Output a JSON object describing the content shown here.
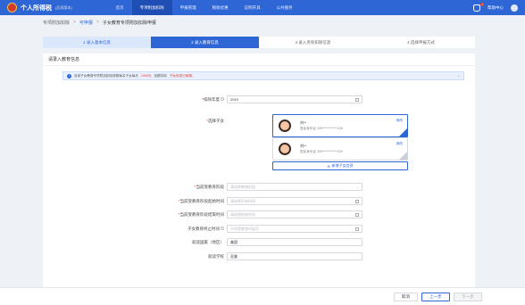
{
  "header": {
    "title": "个人所得税",
    "subtitle": "(后续版本)",
    "nav": [
      "首页",
      "专项附加扣除",
      "申报管理",
      "税收优惠",
      "证明开具",
      "公共服务"
    ],
    "notify_count": "1",
    "user_link": "帮助中心"
  },
  "breadcrumb": [
    "专项附加扣除",
    "可申报",
    "子女教育专项附加扣除申报"
  ],
  "steps": [
    "1 录入基本信息",
    "2 录入教育信息",
    "3 录入另有扣除信息",
    "4 选择申报方式"
  ],
  "section_title": "请录入教育信息",
  "notice": {
    "text": "目前子女教育专项附加扣除按照每名子女每月",
    "highlight": "1000元",
    "text2": "定额扣除",
    "highlight2": "子女信息已填报。"
  },
  "form": {
    "year_label": "扣除年度",
    "year_value": "2019",
    "child_label": "选择子女",
    "children": [
      {
        "name": "刘**",
        "id": "居民身份证   339************228",
        "edit": "修改"
      },
      {
        "name": "刘**",
        "id": "居民身份证   339************229",
        "edit": "修改"
      }
    ],
    "add_child": "新增子女信息",
    "stage_label": "当前受教育阶段",
    "stage_placeholder": "请选择教育阶段",
    "start_label": "当前受教育阶段起始时间",
    "start_placeholder": "请选择开始时间",
    "end_label": "当前受教育阶段结束时间",
    "end_placeholder": "请选择结束时间",
    "stop_label": "子女教育终止时间",
    "stop_placeholder": "不再受教育时填写",
    "country_label": "就读国家（地区）",
    "country_value": "美国",
    "school_label": "就读学校",
    "school_value": "亚美"
  },
  "footer": {
    "cancel": "取消",
    "prev": "上一步",
    "next": "下一步"
  }
}
